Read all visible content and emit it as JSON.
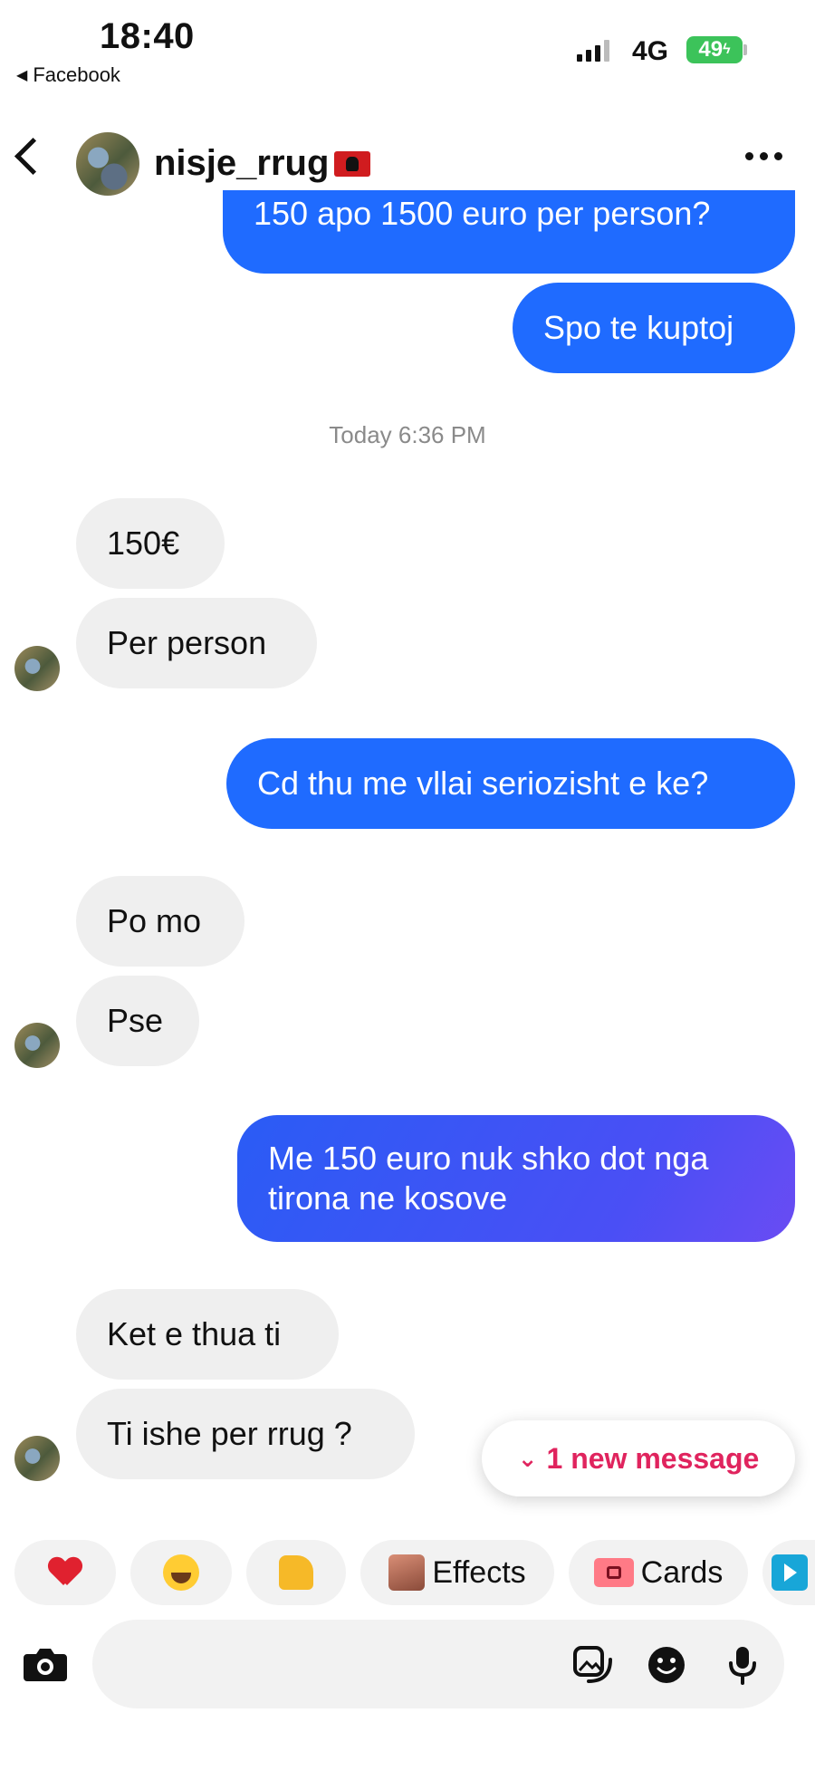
{
  "status_bar": {
    "time": "18:40",
    "back_app": "Facebook",
    "network": "4G",
    "battery": "49"
  },
  "header": {
    "contact_name": "nisje_rrug"
  },
  "messages": [
    {
      "dir": "out",
      "text": "150 apo 1500 euro per person?"
    },
    {
      "dir": "out",
      "text": "Spo te kuptoj"
    },
    {
      "dir": "in",
      "text": "150€"
    },
    {
      "dir": "in",
      "text": "Per person"
    },
    {
      "dir": "out",
      "text": "Cd thu me vllai seriozisht e ke?"
    },
    {
      "dir": "in",
      "text": "Po mo"
    },
    {
      "dir": "in",
      "text": "Pse"
    },
    {
      "dir": "out",
      "text": "Me 150 euro nuk shko dot nga tirona ne kosove"
    },
    {
      "dir": "in",
      "text": "Ket e thua ti"
    },
    {
      "dir": "in",
      "text": "Ti ishe per rrug ?"
    }
  ],
  "timestamp": "Today 6:36 PM",
  "new_message_pill": "1 new message",
  "reactions": {
    "effects_label": "Effects",
    "cards_label": "Cards"
  },
  "colors": {
    "outgoing_bubble": "#1f6bff",
    "incoming_bubble": "#efefef",
    "new_message_accent": "#e0245e"
  }
}
